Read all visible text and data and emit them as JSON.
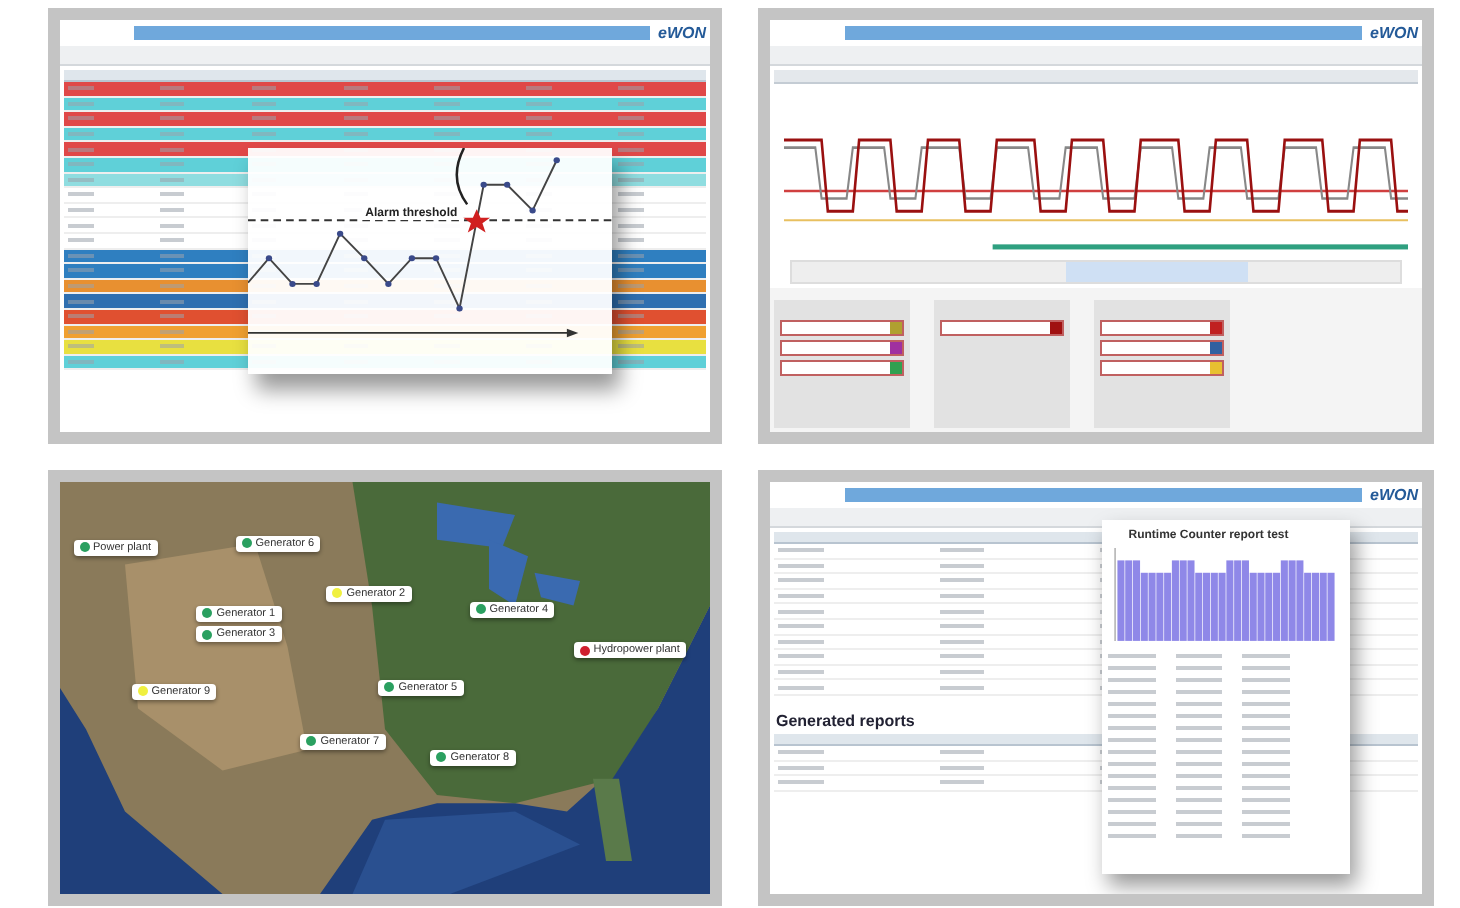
{
  "panels": [
    {
      "kind": "alarms",
      "logo": "eWON",
      "threshold_label": "Alarm threshold",
      "rows": [
        {
          "color": "#e04848"
        },
        {
          "color": "#5fd0d8"
        },
        {
          "color": "#e04848"
        },
        {
          "color": "#5fd0d8"
        },
        {
          "color": "#e04848"
        },
        {
          "color": "#5fd0d8"
        },
        {
          "color": "#8fdde0"
        },
        {
          "color": "#ffffff"
        },
        {
          "color": "#ffffff"
        },
        {
          "color": "#ffffff"
        },
        {
          "color": "#ffffff"
        },
        {
          "color": "#2f7fc0"
        },
        {
          "color": "#2f7fc0"
        },
        {
          "color": "#e89030"
        },
        {
          "color": "#2f6fb0"
        },
        {
          "color": "#e05030"
        },
        {
          "color": "#f0a030"
        },
        {
          "color": "#e8e040"
        },
        {
          "color": "#5fd0d8"
        }
      ]
    },
    {
      "kind": "trend",
      "logo": "eWON",
      "groups": [
        {
          "swatches": [
            {
              "color": "#b0a030"
            },
            {
              "color": "#a030a0"
            },
            {
              "color": "#30a050"
            }
          ]
        },
        {
          "swatches": [
            {
              "color": "#a01010"
            }
          ]
        },
        {
          "swatches": [
            {
              "color": "#c02020"
            },
            {
              "color": "#3060a0"
            },
            {
              "color": "#e8c030"
            }
          ]
        }
      ]
    },
    {
      "kind": "map",
      "markers": [
        {
          "label": "Power plant",
          "color": "#2aa060"
        },
        {
          "label": "Generator 6",
          "color": "#2aa060"
        },
        {
          "label": "Generator 2",
          "color": "#f0f040"
        },
        {
          "label": "Generator 1",
          "color": "#2aa060"
        },
        {
          "label": "Generator 3",
          "color": "#2aa060"
        },
        {
          "label": "Generator 9",
          "color": "#f0f040"
        },
        {
          "label": "Generator 4",
          "color": "#2aa060"
        },
        {
          "label": "Hydropower plant",
          "color": "#d02030"
        },
        {
          "label": "Generator 5",
          "color": "#2aa060"
        },
        {
          "label": "Generator 7",
          "color": "#2aa060"
        },
        {
          "label": "Generator 8",
          "color": "#2aa060"
        }
      ]
    },
    {
      "kind": "reports",
      "logo": "eWON",
      "heading": "Generated reports",
      "popup_title": "Runtime Counter report test"
    }
  ]
}
